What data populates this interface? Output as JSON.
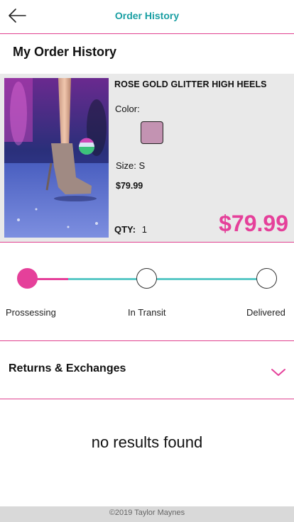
{
  "header": {
    "title": "Order History",
    "back_icon": "arrow-left-icon"
  },
  "page": {
    "title": "My Order History"
  },
  "order": {
    "product_name": "ROSE GOLD GLITTER HIGH HEELS",
    "color_label": "Color:",
    "color_swatch": "#c393b2",
    "size_label": "Size: S",
    "price": "$79.99",
    "qty_label": "QTY:",
    "qty_value": "1",
    "total_price": "$79.99"
  },
  "tracking": {
    "steps": [
      {
        "label": "Prossessing",
        "state": "active"
      },
      {
        "label": "In Transit",
        "state": "pending"
      },
      {
        "label": "Delivered",
        "state": "pending"
      }
    ],
    "progress_color": "#e5409a",
    "pending_color": "#5cc9c7"
  },
  "returns": {
    "label": "Returns & Exchanges",
    "icon": "chevron-down-icon"
  },
  "results": {
    "empty_text": "no results found"
  },
  "footer": {
    "copyright": "©2019 Taylor Maynes"
  },
  "colors": {
    "accent_pink": "#e5409a",
    "accent_teal": "#1a9fa3"
  }
}
